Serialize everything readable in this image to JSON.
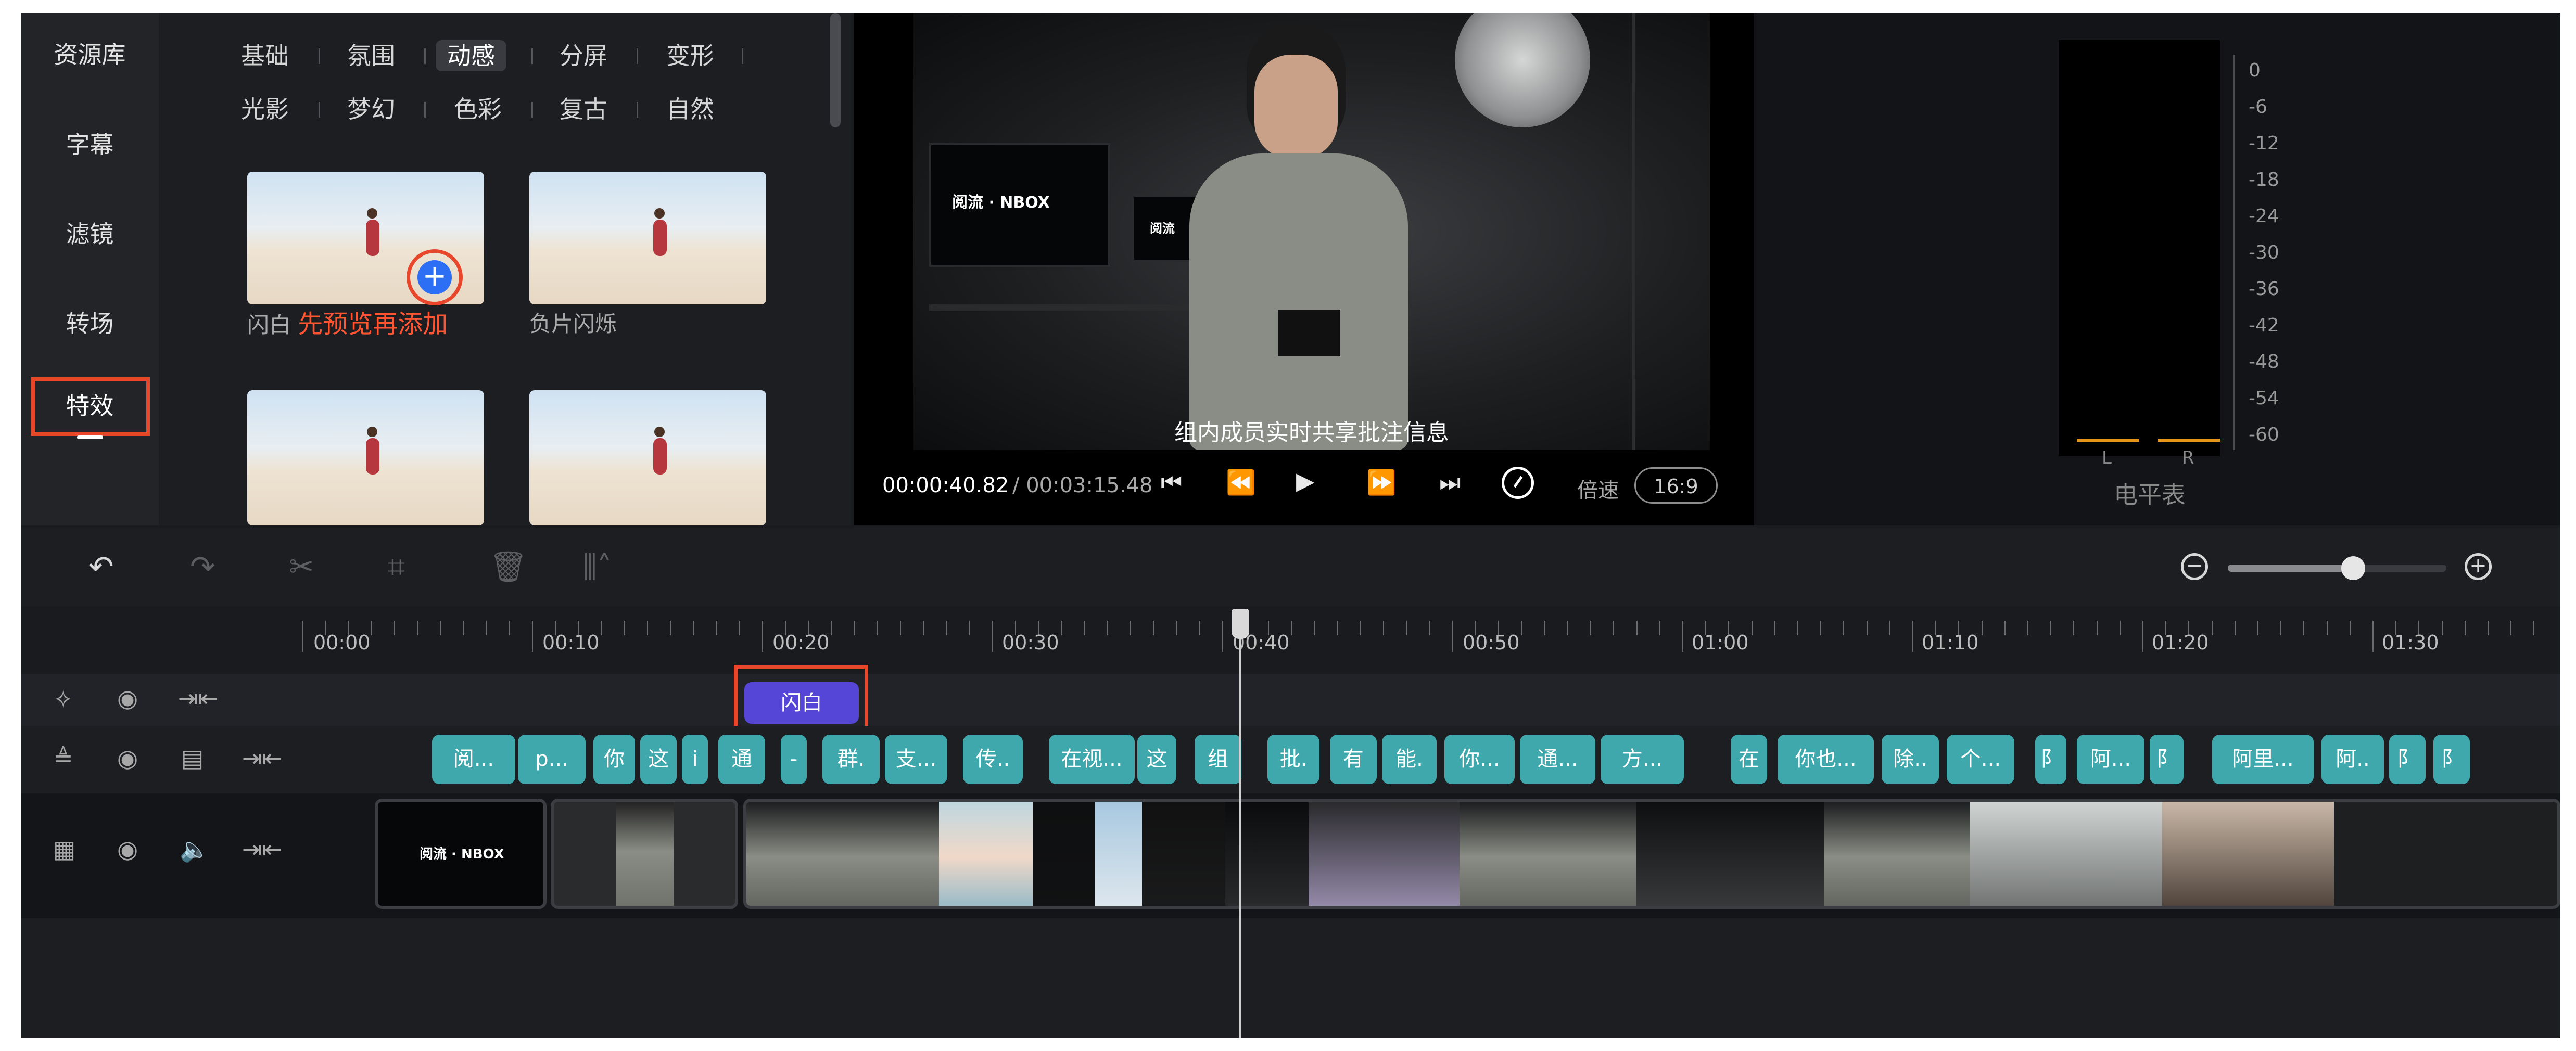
{
  "nav": {
    "items": [
      "资源库",
      "字幕",
      "滤镜",
      "转场",
      "特效"
    ],
    "active": "特效"
  },
  "categories": {
    "row1": [
      "基础",
      "氛围",
      "动感",
      "分屏",
      "变形"
    ],
    "row2": [
      "光影",
      "梦幻",
      "色彩",
      "复古",
      "自然"
    ],
    "active": "动感"
  },
  "effects": [
    {
      "label": "闪白",
      "hint": "先预览再添加"
    },
    {
      "label": "负片闪烁"
    }
  ],
  "preview": {
    "subtitle": "组内成员实时共享批注信息",
    "current_time": "00:00:40.82",
    "total_time": "/ 00:03:15.48",
    "speed_label": "倍速",
    "ratio": "16:9",
    "logo_text": "阅流 · NBOX",
    "screen_text": "阅流"
  },
  "meter": {
    "title": "电平表",
    "scale": [
      "0",
      "-6",
      "-12",
      "-18",
      "-24",
      "-30",
      "-36",
      "-42",
      "-48",
      "-54",
      "-60"
    ],
    "left": "L",
    "right": "R"
  },
  "toolbar": {
    "tools": [
      "undo-icon",
      "redo-icon",
      "scissors-icon",
      "crop-icon",
      "delete-icon",
      "audio-wave-icon"
    ],
    "zoom_level": 0.55
  },
  "timeline": {
    "ticks": [
      "00:00",
      "00:10",
      "00:20",
      "00:30",
      "00:40",
      "00:50",
      "01:00",
      "01:10",
      "01:20",
      "01:30"
    ],
    "playhead": "00:40",
    "effect_clip": "闪白",
    "subtitle_clips": [
      "阅...",
      "p...",
      "你",
      "这",
      "i",
      "通",
      "-",
      "群.",
      "支...",
      "传..",
      "在视...",
      "这",
      "组",
      "批.",
      "有",
      "能.",
      "你...",
      "通...",
      "方...",
      "在",
      "你也...",
      "除..",
      "个...",
      "阝",
      "阿...",
      "阝",
      "阿里...",
      "阿..",
      "阝",
      "阝"
    ],
    "video_logo": "阅流 · NBOX"
  },
  "colors": {
    "accent_blue": "#2c6ff5",
    "highlight_red": "#e8472b",
    "effect_purple": "#5646d8",
    "subtitle_teal": "#3fa8ad",
    "meter_orange": "#e8951c"
  }
}
